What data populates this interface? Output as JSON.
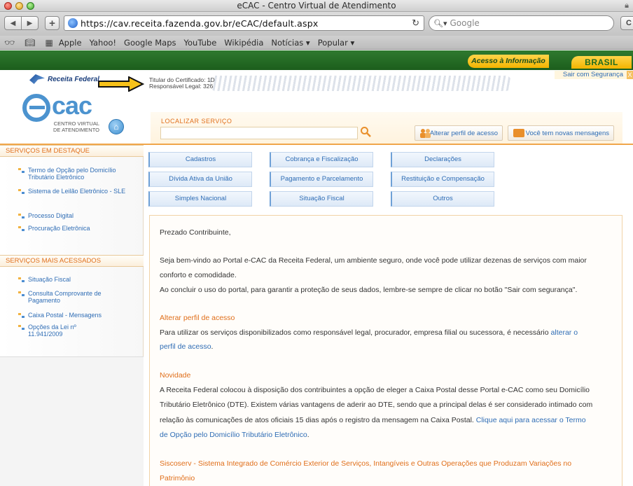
{
  "browser": {
    "window_title": "eCAC - Centro Virtual de Atendimento",
    "url": "https://cav.receita.fazenda.gov.br/eCAC/default.aspx",
    "search_placeholder": "Google",
    "bookmarks": [
      "Apple",
      "Yahoo!",
      "Google Maps",
      "YouTube",
      "Wikipédia",
      "Notícias ▾",
      "Popular ▾"
    ]
  },
  "govbar": {
    "acesso": "Acesso à Informação",
    "brasil": "BRASIL"
  },
  "header": {
    "rf_logo_text": "Receita Federal",
    "titular": "Titular do Certificado: 1D",
    "responsavel": "Responsável Legal: 326",
    "sair": "Sair com Segurança",
    "sair_close": "X",
    "ecac_word": "cac",
    "ecac_sub_1": "CENTRO VIRTUAL",
    "ecac_sub_2": "DE ATENDIMENTO",
    "localizar_label": "LOCALIZAR SERVIÇO",
    "perfil_btn": "Alterar perfil de acesso",
    "msg_btn": "Você tem novas mensagens"
  },
  "sidebar": {
    "destaque_title": "SERVIÇOS EM DESTAQUE",
    "destaque_items": [
      "Termo de Opção pelo Domicílio Tributário Eletrônico",
      "Sistema de Leilão Eletrônico - SLE",
      "Processo Digital",
      "Procuração Eletrônica"
    ],
    "acessados_title": "SERVIÇOS MAIS ACESSADOS",
    "acessados_items": [
      "Situação Fiscal",
      "Consulta Comprovante de Pagamento",
      "Caixa Postal - Mensagens",
      "Opções da Lei nº 11.941/2009"
    ]
  },
  "services": [
    "Cadastros",
    "Cobrança e Fiscalização",
    "Declarações",
    "Dívida Ativa da União",
    "Pagamento e Parcelamento",
    "Restituição e Compensação",
    "Simples Nacional",
    "Situação Fiscal",
    "Outros"
  ],
  "content": {
    "greeting": "Prezado Contribuinte,",
    "welcome_1": "Seja bem-vindo ao Portal e-CAC da Receita Federal, um ambiente seguro, onde você pode utilizar dezenas de serviços com maior",
    "welcome_2": "conforto e comodidade.",
    "welcome_3": "Ao concluir o uso do portal, para garantir a proteção de seus dados, lembre-se sempre de clicar no botão \"Sair com segurança\".",
    "perfil_head": "Alterar perfil de acesso",
    "perfil_1": "Para utilizar os serviços disponibilizados como responsável legal, procurador, empresa filial ou sucessora, é necessário",
    "perfil_link_a": "alterar o",
    "perfil_link_b": "perfil de acesso",
    "perfil_end": ".",
    "novidade_head": "Novidade",
    "novidade_1": "A Receita Federal colocou à disposição dos contribuintes a opção de eleger a Caixa Postal desse Portal e-CAC como seu Domicílio",
    "novidade_2": "Tributário Eletrônico (DTE). Existem várias vantagens de aderir ao DTE, sendo que a principal delas é ser considerado intimado com",
    "novidade_3": "relação às comunicações de atos oficiais 15 dias após o registro da mensagem na Caixa Postal.",
    "novidade_link_a": "Clique aqui para acessar o Termo",
    "novidade_link_b": "de Opção pelo Domicílio Tributário Eletrônico",
    "novidade_end": ".",
    "siscoserv_1": "Siscoserv - Sistema Integrado de Comércio Exterior de Serviços, Intangíveis e Outras Operações que Produzam Variações no",
    "siscoserv_2": "Patrimônio"
  }
}
